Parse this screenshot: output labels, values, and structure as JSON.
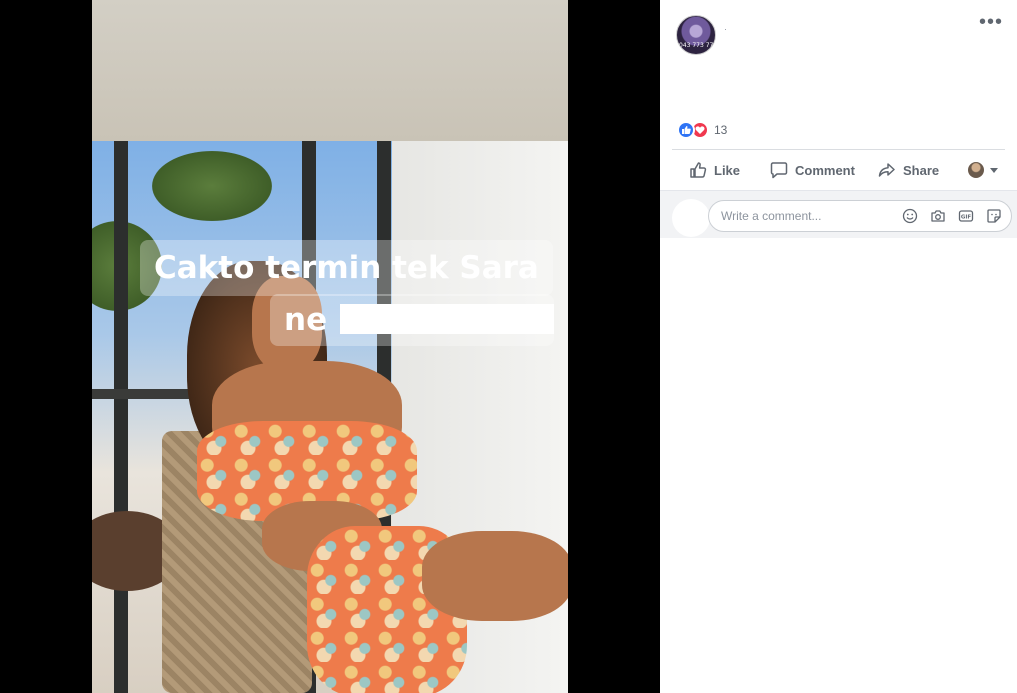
{
  "photo": {
    "caption_line1": "Cakto termin tek Sara",
    "caption_line2": "ne"
  },
  "post": {
    "author_avatar_text": "043 773 77",
    "author_name": "·",
    "reactions_count": "13"
  },
  "actions": {
    "like": "Like",
    "comment": "Comment",
    "share": "Share"
  },
  "comment_box": {
    "placeholder": "Write a comment..."
  },
  "colors": {
    "like_blue": "#2f74f5",
    "love_red": "#f0384f",
    "action_gray": "#606770"
  }
}
